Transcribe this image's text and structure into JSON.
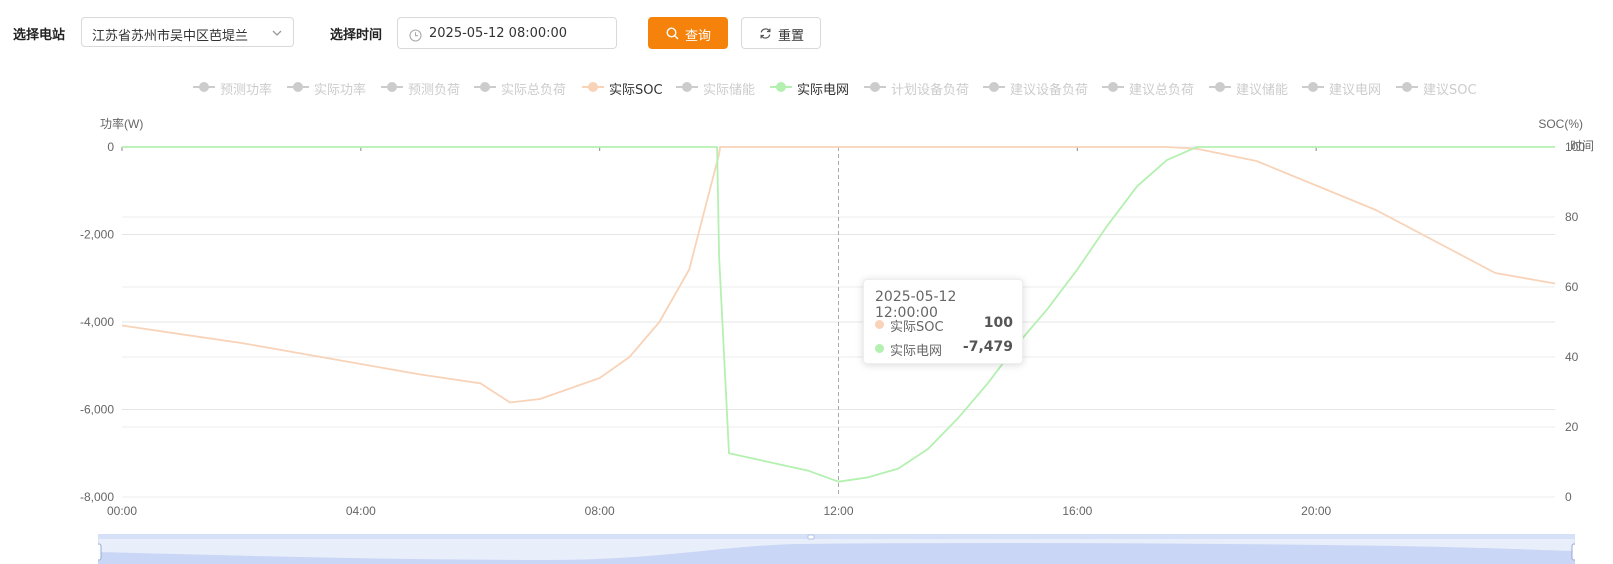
{
  "toolbar": {
    "station_label": "选择电站",
    "station_value": "江苏省苏州市吴中区芭堤兰",
    "time_label": "选择时间",
    "time_value": "2025-05-12 08:00:00",
    "query_label": "查询",
    "reset_label": "重置",
    "accent_color": "#f5820b"
  },
  "legend": [
    {
      "name": "预测功率",
      "active": false,
      "color": "#cccccc"
    },
    {
      "name": "实际功率",
      "active": false,
      "color": "#cccccc"
    },
    {
      "name": "预测负荷",
      "active": false,
      "color": "#cccccc"
    },
    {
      "name": "实际总负荷",
      "active": false,
      "color": "#cccccc"
    },
    {
      "name": "实际SOC",
      "active": true,
      "color": "#f8d3b8"
    },
    {
      "name": "实际储能",
      "active": false,
      "color": "#cccccc"
    },
    {
      "name": "实际电网",
      "active": true,
      "color": "#b4f0b0"
    },
    {
      "name": "计划设备负荷",
      "active": false,
      "color": "#cccccc"
    },
    {
      "name": "建议设备负荷",
      "active": false,
      "color": "#cccccc"
    },
    {
      "name": "建议总负荷",
      "active": false,
      "color": "#cccccc"
    },
    {
      "name": "建议储能",
      "active": false,
      "color": "#cccccc"
    },
    {
      "name": "建议电网",
      "active": false,
      "color": "#cccccc"
    },
    {
      "name": "建议SOC",
      "active": false,
      "color": "#cccccc"
    }
  ],
  "tooltip": {
    "title": "2025-05-12 12:00:00",
    "rows": [
      {
        "name": "实际SOC",
        "value": "100",
        "color": "#f8d3b8"
      },
      {
        "name": "实际电网",
        "value": "-7,479",
        "color": "#b4f0b0"
      }
    ]
  },
  "chart_data": {
    "type": "line",
    "y_left_label": "功率(W)",
    "y_right_label": "SOC(%)",
    "x_axis_name": "时间",
    "x_ticks": [
      "00:00",
      "04:00",
      "08:00",
      "12:00",
      "16:00",
      "20:00"
    ],
    "xlim": [
      "00:00",
      "24:00"
    ],
    "y_left_ticks": [
      "0",
      "-2,000",
      "-4,000",
      "-6,000",
      "-8,000"
    ],
    "y_left_lim": [
      -8000,
      0
    ],
    "y_right_ticks": [
      "100",
      "80",
      "60",
      "40",
      "20",
      "0"
    ],
    "y_right_lim": [
      0,
      100
    ],
    "grid": true,
    "cursor_time": "12:00",
    "series": [
      {
        "name": "实际SOC",
        "axis": "right",
        "color": "#f8d3b8",
        "x": [
          "00:00",
          "01:00",
          "02:00",
          "03:00",
          "04:00",
          "05:00",
          "06:00",
          "06:30",
          "07:00",
          "08:00",
          "08:30",
          "09:00",
          "09:30",
          "10:00",
          "10:01",
          "12:00",
          "16:00",
          "17:30",
          "18:00",
          "19:00",
          "20:00",
          "21:00",
          "22:00",
          "23:00",
          "24:00"
        ],
        "y": [
          49,
          46.5,
          44,
          41,
          38,
          35,
          32.5,
          27,
          28,
          34,
          40,
          50,
          65,
          98,
          100,
          100,
          100,
          100,
          99.5,
          96,
          89,
          82,
          73,
          64,
          61
        ]
      },
      {
        "name": "实际电网",
        "axis": "left",
        "color": "#b4f0b0",
        "x": [
          "00:00",
          "09:58",
          "10:00",
          "10:10",
          "10:30",
          "11:00",
          "11:30",
          "12:00",
          "12:30",
          "13:00",
          "13:30",
          "14:00",
          "14:30",
          "15:00",
          "15:30",
          "16:00",
          "16:30",
          "17:00",
          "17:30",
          "17:55",
          "18:00",
          "20:00",
          "24:00"
        ],
        "y": [
          0,
          0,
          -2500,
          -7000,
          -7100,
          -7250,
          -7400,
          -7650,
          -7550,
          -7350,
          -6900,
          -6200,
          -5400,
          -4500,
          -3700,
          -2800,
          -1800,
          -900,
          -300,
          -50,
          0,
          0,
          0
        ]
      }
    ]
  },
  "zoom": {
    "range": [
      "00:00",
      "24:00"
    ]
  }
}
